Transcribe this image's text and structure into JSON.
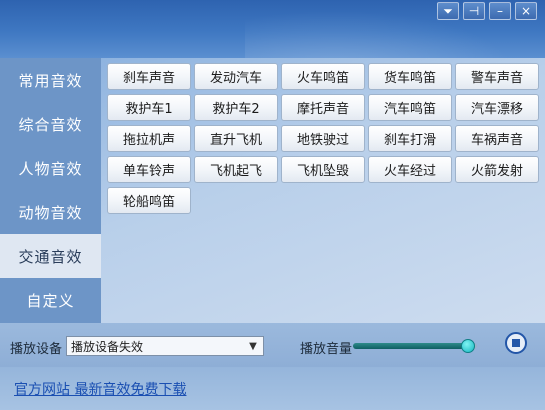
{
  "window": {
    "buttons": [
      {
        "name": "menu-dropdown-icon",
        "glyph": "⏷"
      },
      {
        "name": "pin-icon",
        "glyph": "⊣"
      },
      {
        "name": "minimize-icon",
        "glyph": "–"
      },
      {
        "name": "close-icon",
        "glyph": "×"
      }
    ]
  },
  "sidebar": {
    "items": [
      {
        "label": "常用音效",
        "active": false
      },
      {
        "label": "综合音效",
        "active": false
      },
      {
        "label": "人物音效",
        "active": false
      },
      {
        "label": "动物音效",
        "active": false
      },
      {
        "label": "交通音效",
        "active": true
      },
      {
        "label": "自定义",
        "active": false
      }
    ]
  },
  "sounds": [
    "刹车声音",
    "发动汽车",
    "火车鸣笛",
    "货车鸣笛",
    "警车声音",
    "救护车1",
    "救护车2",
    "摩托声音",
    "汽车鸣笛",
    "汽车漂移",
    "拖拉机声",
    "直升飞机",
    "地铁驶过",
    "刹车打滑",
    "车祸声音",
    "单车铃声",
    "飞机起飞",
    "飞机坠毁",
    "火车经过",
    "火箭发射",
    "轮船鸣笛"
  ],
  "controls": {
    "device_label": "播放设备",
    "device_value": "播放设备失效",
    "volume_label": "播放音量",
    "volume_level": 0.93
  },
  "footer": {
    "link_text": "官方网站 最新音效免费下载"
  },
  "colors": {
    "accent": "#2356a8",
    "link": "#1a4fb2",
    "volume_fill": "#0f5e62"
  }
}
